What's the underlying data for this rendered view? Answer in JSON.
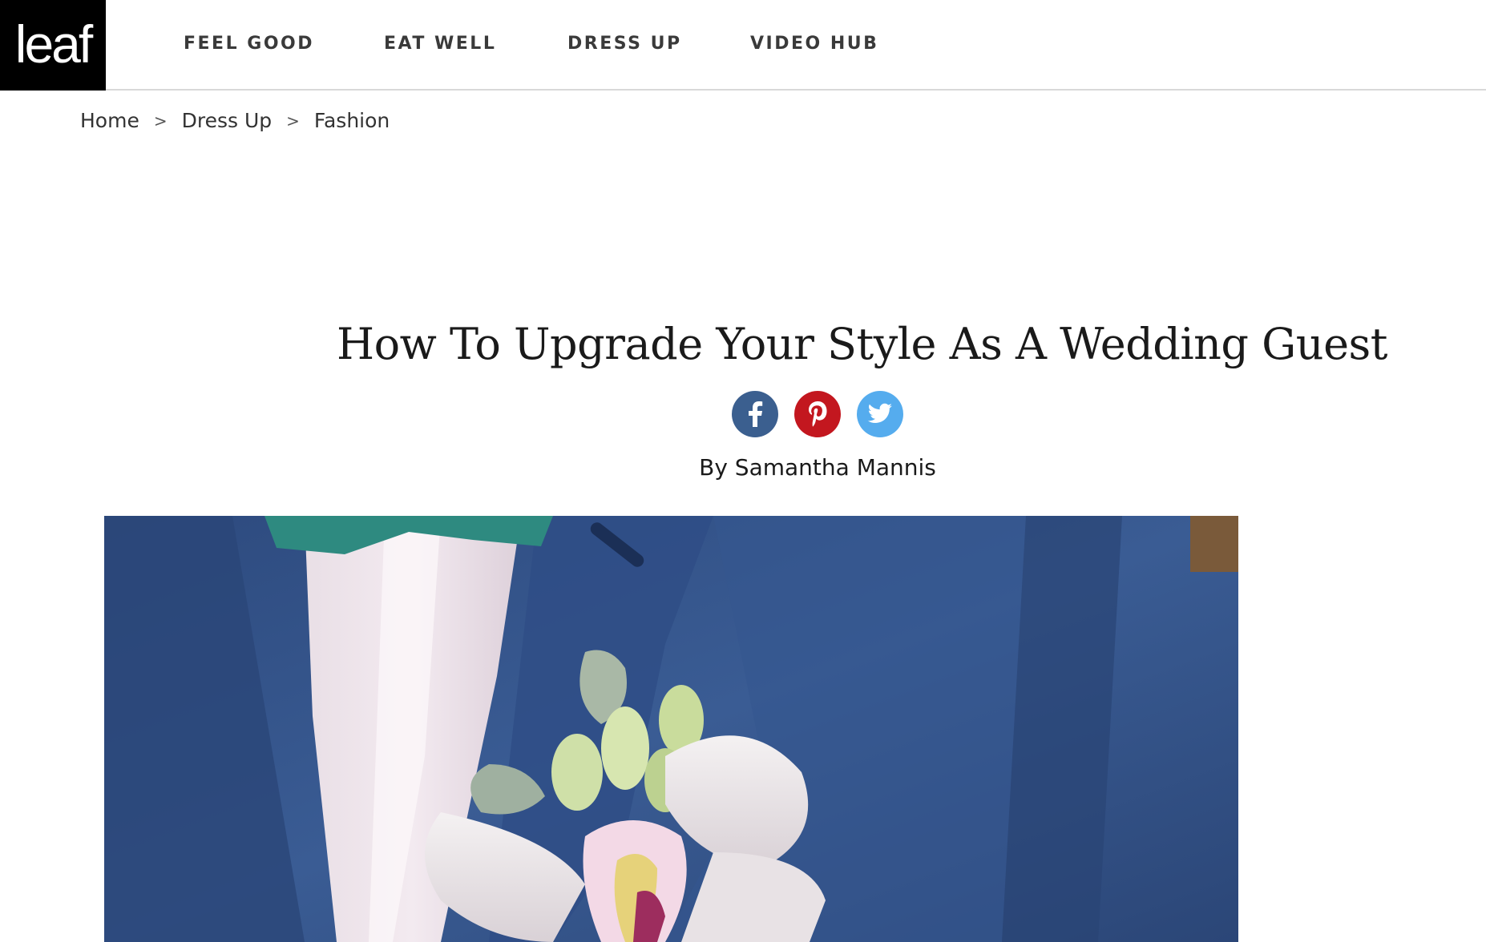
{
  "logo": {
    "text": "leaf"
  },
  "nav": {
    "items": [
      {
        "label": "FEEL GOOD"
      },
      {
        "label": "EAT WELL"
      },
      {
        "label": "DRESS UP"
      },
      {
        "label": "VIDEO HUB"
      }
    ]
  },
  "breadcrumb": {
    "items": [
      "Home",
      "Dress Up",
      "Fashion"
    ],
    "separator": ">"
  },
  "article": {
    "title": "How To Upgrade Your Style As A Wedding Guest",
    "byline": "By Samantha Mannis"
  },
  "share": {
    "facebook": {
      "icon": "facebook-icon",
      "color": "#3b5f8f"
    },
    "pinterest": {
      "icon": "pinterest-icon",
      "color": "#c3171f"
    },
    "twitter": {
      "icon": "twitter-icon",
      "color": "#55acee"
    }
  },
  "hero_image": {
    "description_icon": "photo-suit-boutonniere"
  }
}
